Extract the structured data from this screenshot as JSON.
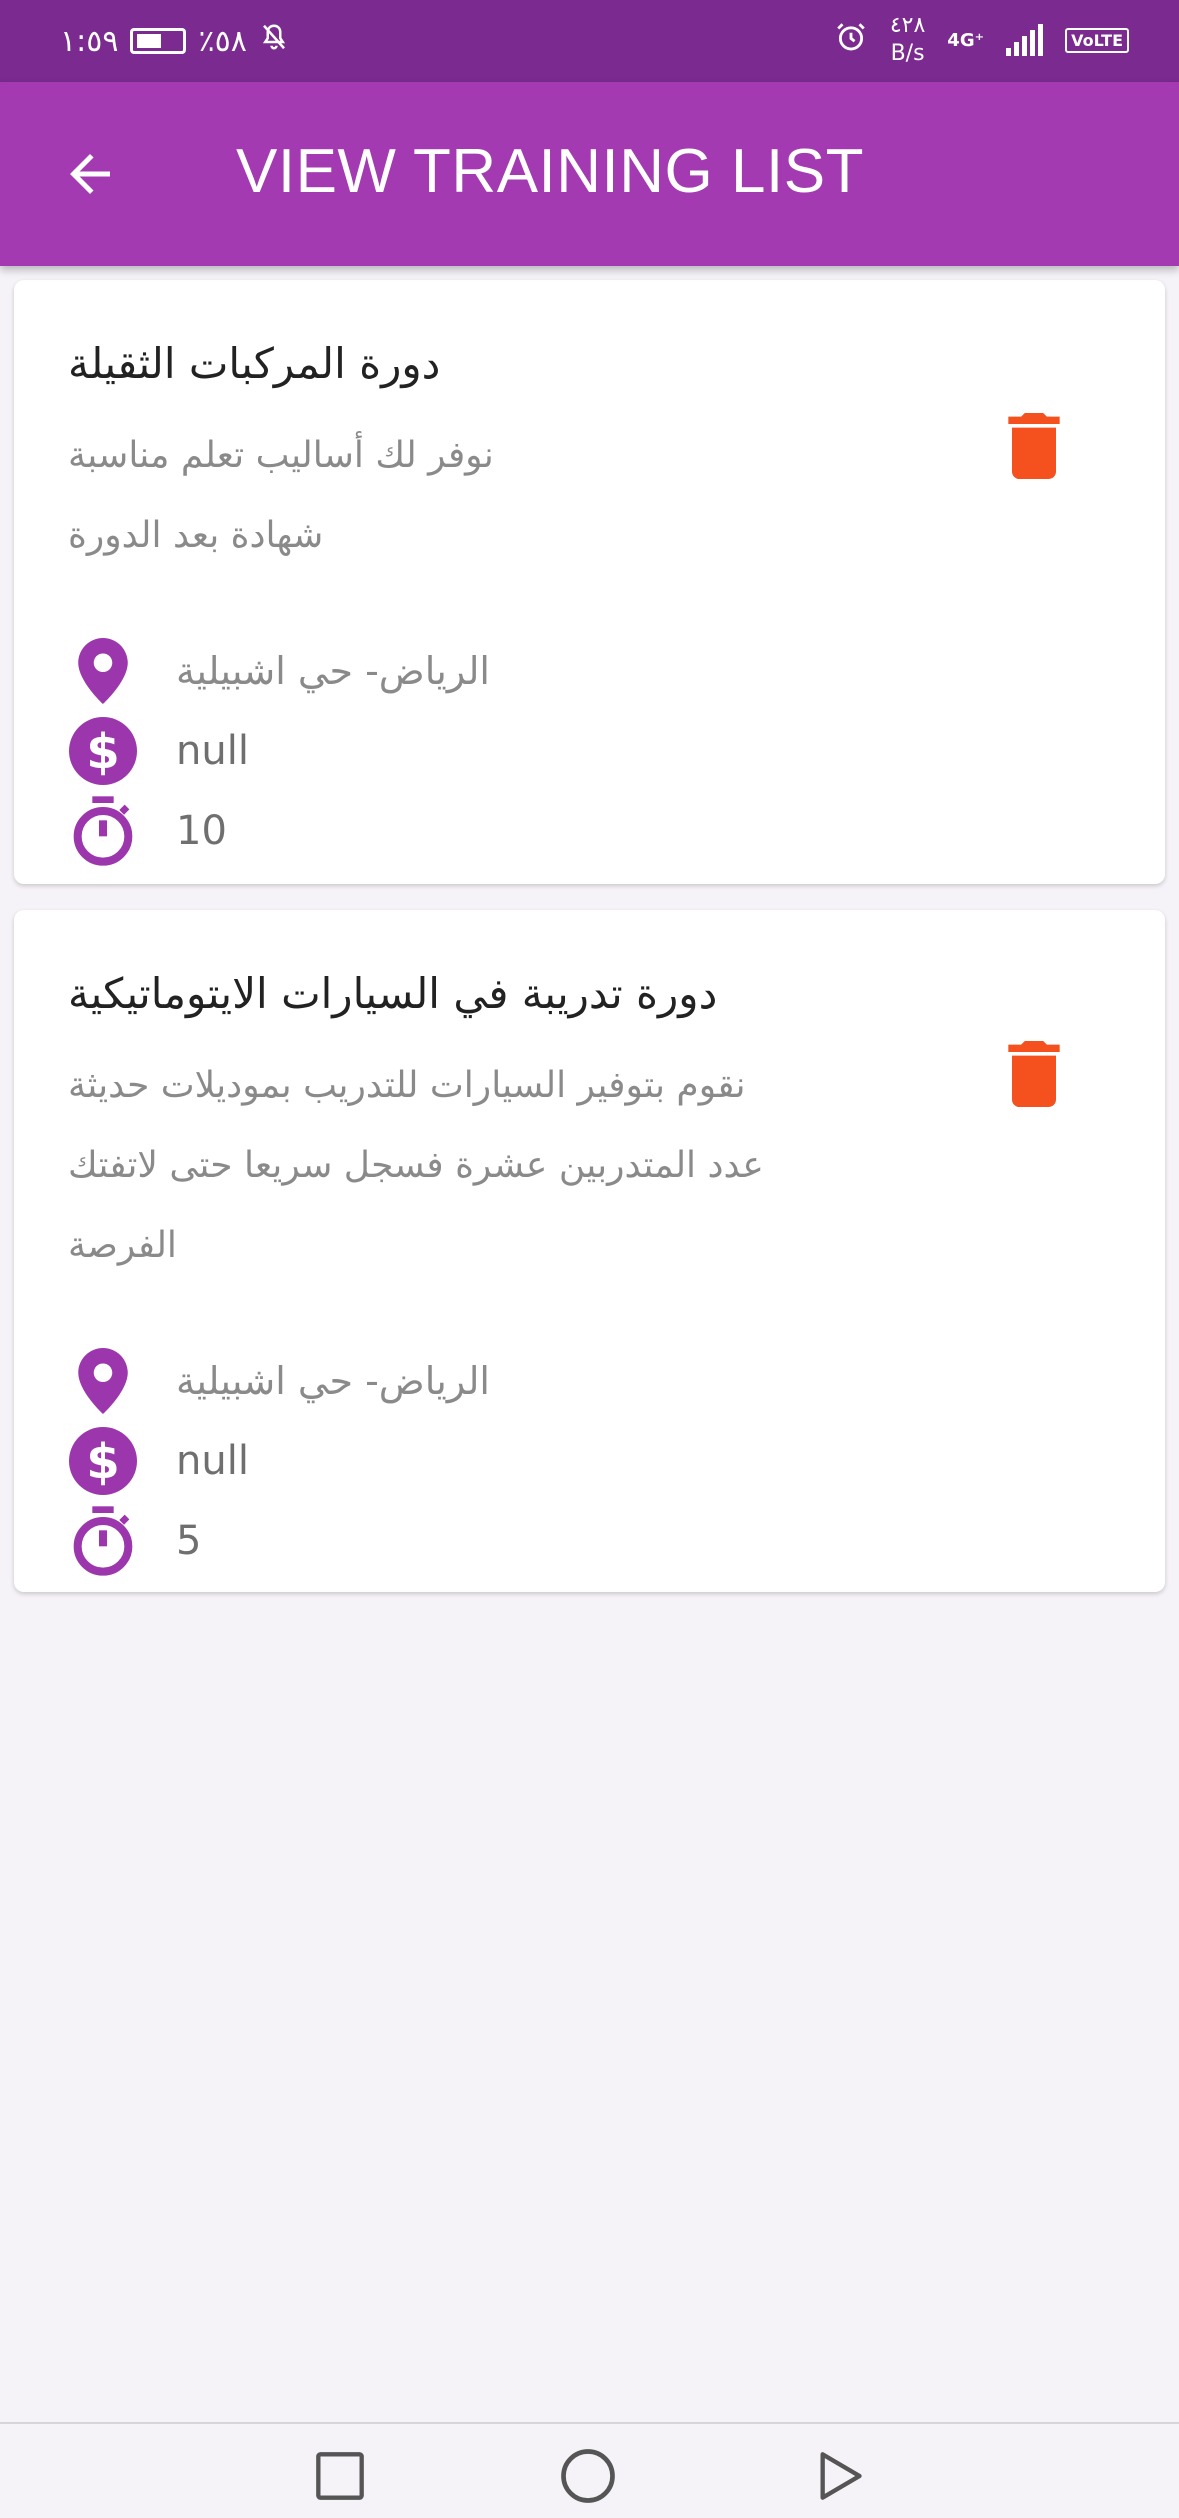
{
  "status_bar": {
    "time": "١:٥٩",
    "battery": "٪٥٨",
    "net_speed_value": "٤٢٨",
    "net_speed_unit": "B/s",
    "network": "4G⁺",
    "volte": "VoLTE",
    "icons": [
      "battery-icon",
      "mute-bell-icon",
      "alarm-icon",
      "signal-icon"
    ]
  },
  "app_bar": {
    "title": "VIEW TRAINING LIST",
    "back_icon": "arrow-back-icon"
  },
  "colors": {
    "status_bar": "#7b2a8f",
    "app_bar": "#a33ab2",
    "accent_icon": "#9c36ac",
    "delete": "#f4511e",
    "background": "#f6f3f8"
  },
  "trainings": [
    {
      "title": "دورة المركبات الثقيلة",
      "description": "نوفر لك أساليب تعلم مناسبة\nشهادة بعد الدورة",
      "location": "الرياض- حي اشبيلية",
      "price": "null",
      "duration": "10"
    },
    {
      "title": "دورة تدريبة في السيارات الايتوماتيكية",
      "description": "نقوم بتوفير السيارات للتدريب بموديلات حديثة\nعدد المتدربين عشرة فسجل سريعا حتى لاتفتك\nالفرصة",
      "location": "الرياض- حي اشبيلية",
      "price": "null",
      "duration": "5"
    }
  ],
  "nav_bar": {
    "buttons": [
      "recents-square-icon",
      "home-circle-icon",
      "back-triangle-icon"
    ]
  }
}
